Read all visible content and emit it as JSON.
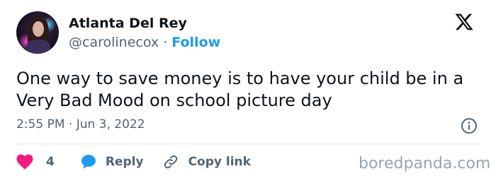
{
  "author": {
    "name": "Atlanta Del Rey",
    "handle": "@carolinecox",
    "separator": "·",
    "follow_label": "Follow"
  },
  "tweet": {
    "text": "One way to save money is to have your child be in a Very Bad Mood on school picture day",
    "timestamp": "2:55 PM · Jun 3, 2022"
  },
  "actions": {
    "like_count": "4",
    "reply_label": "Reply",
    "copy_link_label": "Copy link"
  },
  "watermark": "boredpanda.com",
  "icons": {
    "brand": "x-logo-icon",
    "info": "info-icon",
    "like": "heart-icon",
    "reply": "speech-bubble-icon",
    "copy": "link-icon"
  },
  "colors": {
    "accent": "#1d9bf0",
    "like": "#f91880",
    "text": "#0f1419",
    "muted": "#536471"
  }
}
